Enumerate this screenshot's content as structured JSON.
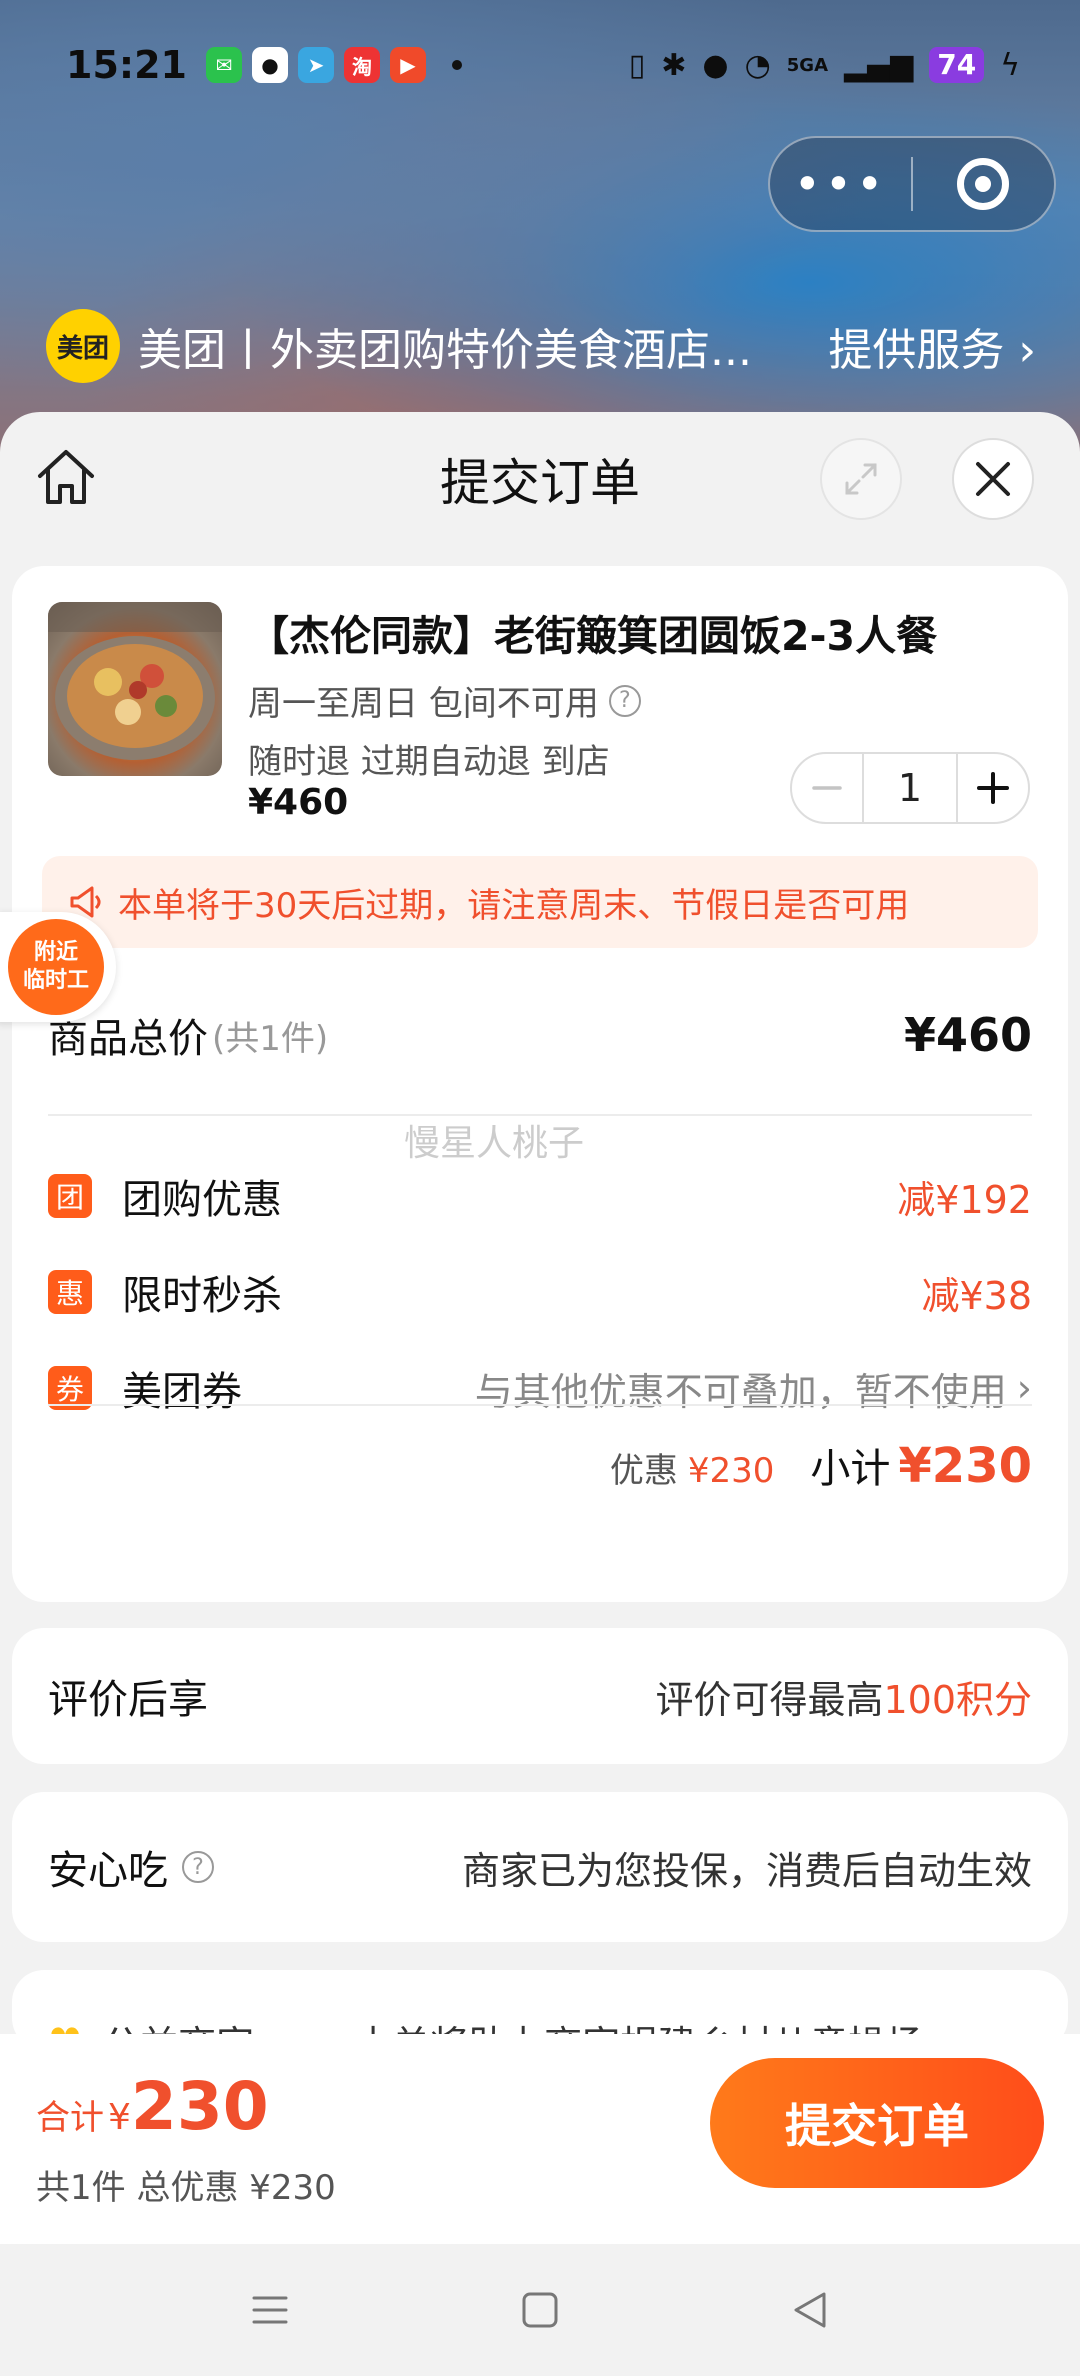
{
  "status_bar": {
    "time": "15:21",
    "battery": "74",
    "network": "5GA"
  },
  "header": {
    "logo_text": "美团",
    "service_title": "美团丨外卖团购特价美食酒店...",
    "service_link": "提供服务",
    "colors": {
      "brand_yellow": "#ffd100"
    }
  },
  "sheet": {
    "title": "提交订单"
  },
  "product": {
    "name": "【杰伦同款】老街簸箕团圆饭2-3人餐",
    "availability": "周一至周日 包间不可用",
    "policy": "随时退 过期自动退 到店",
    "price": "¥460",
    "quantity": "1"
  },
  "expire_note": "本单将于30天后过期，请注意周末、节假日是否可用",
  "total": {
    "label": "商品总价",
    "count": "(共1件)",
    "value": "¥460"
  },
  "watermark": "慢星人桃子",
  "discounts": [
    {
      "badge": "团",
      "name": "团购优惠",
      "value": "减¥192"
    },
    {
      "badge": "惠",
      "name": "限时秒杀",
      "value": "减¥38"
    },
    {
      "badge": "券",
      "name": "美团券",
      "value": "与其他优惠不可叠加，暂不使用"
    }
  ],
  "subtotal": {
    "discount_label": "优惠",
    "discount_value": "¥230",
    "subtotal_label": "小计",
    "subtotal_value": "¥230"
  },
  "review": {
    "label": "评价后享",
    "text": "评价可得最高",
    "points": "100积分"
  },
  "safe": {
    "label": "安心吃",
    "text": "商家已为您投保，消费后自动生效"
  },
  "peek": {
    "label": "公益商家",
    "text": "本单将助力商家捐建乡村儿童操场"
  },
  "float_tag": {
    "line1": "附近",
    "line2": "临时工"
  },
  "bottom": {
    "total_label": "合计",
    "currency": "¥",
    "total_amount": "230",
    "summary": "共1件 总优惠 ¥230",
    "submit_label": "提交订单"
  },
  "theme": {
    "accent": "#f0502d",
    "button_gradient_start": "#ff7a1a",
    "button_gradient_end": "#ff4d1a"
  }
}
